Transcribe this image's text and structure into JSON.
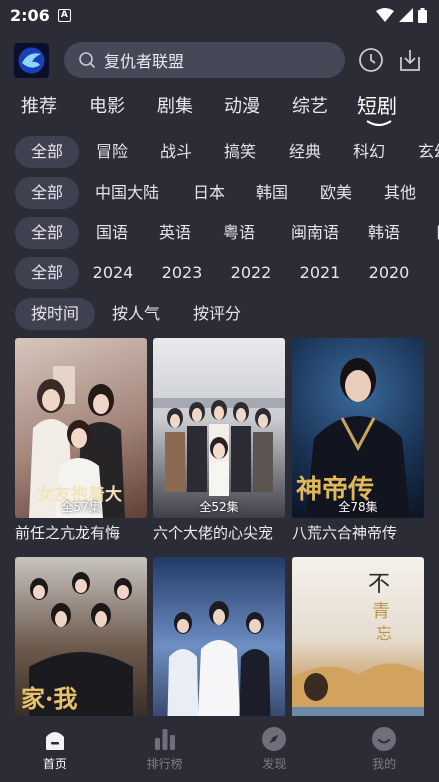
{
  "status": {
    "time": "2:06"
  },
  "search": {
    "placeholder": "复仇者联盟"
  },
  "categories": [
    {
      "label": "推荐"
    },
    {
      "label": "电影"
    },
    {
      "label": "剧集"
    },
    {
      "label": "动漫"
    },
    {
      "label": "综艺"
    },
    {
      "label": "短剧"
    }
  ],
  "active_category": "短剧",
  "filters": {
    "genre": [
      "全部",
      "冒险",
      "战斗",
      "搞笑",
      "经典",
      "科幻",
      "玄幻"
    ],
    "region": [
      "全部",
      "中国大陆",
      "日本",
      "韩国",
      "欧美",
      "其他"
    ],
    "language": [
      "全部",
      "国语",
      "英语",
      "粤语",
      "闽南语",
      "韩语",
      "日语"
    ],
    "year": [
      "全部",
      "2024",
      "2023",
      "2022",
      "2021",
      "2020"
    ],
    "sort": [
      "按时间",
      "按人气",
      "按评分"
    ]
  },
  "cards": [
    {
      "title": "前任之亢龙有悔",
      "episodes": "全57集",
      "colors": [
        "#c9b9b2",
        "#8f6e63"
      ]
    },
    {
      "title": "六个大佬的心尖宠",
      "episodes": "全52集",
      "colors": [
        "#d8d9dc",
        "#4d4f58"
      ]
    },
    {
      "title": "八荒六合神帝传",
      "episodes": "全78集",
      "colors": [
        "#27466a",
        "#0e1b2f"
      ]
    },
    {
      "title": "",
      "episodes": "",
      "colors": [
        "#6e5a4a",
        "#2e241d"
      ]
    },
    {
      "title": "",
      "episodes": "",
      "colors": [
        "#5d7aa8",
        "#1e2a45"
      ]
    },
    {
      "title": "",
      "episodes": "",
      "colors": [
        "#e8e2d6",
        "#c2a37a"
      ]
    }
  ],
  "nav": [
    {
      "label": "首页",
      "icon": "home-icon"
    },
    {
      "label": "排行榜",
      "icon": "ranking-icon"
    },
    {
      "label": "发现",
      "icon": "discover-icon"
    },
    {
      "label": "我的",
      "icon": "profile-icon"
    }
  ],
  "colors": {
    "background": "#2b2c35",
    "chip_selected": "#3f4150",
    "search_bg": "#464857"
  }
}
